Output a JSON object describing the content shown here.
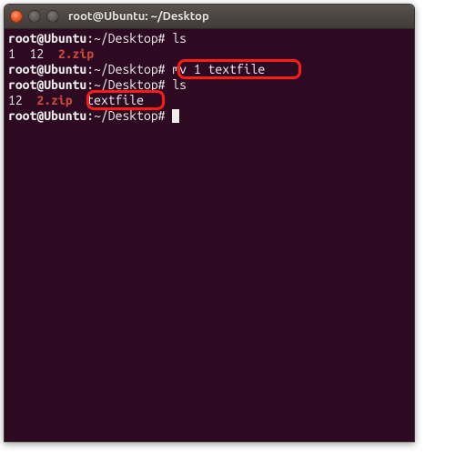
{
  "window": {
    "title": "root@Ubuntu: ~/Desktop"
  },
  "prompt": {
    "user_host": "root@Ubuntu",
    "path": "~/Desktop",
    "sep": ":",
    "end": "#"
  },
  "lines": {
    "cmd_ls1": "ls",
    "cmd_mv": "mv 1 textfile",
    "cmd_ls2": "ls",
    "cmd_empty": "",
    "ls1_item1": "1",
    "ls1_item2": "12",
    "ls1_item3": "2.zip",
    "ls2_item1": "12",
    "ls2_item2": "2.zip",
    "ls2_item3": "textfile"
  },
  "annotations": {
    "box1_label": "mv-command-highlight",
    "box2_label": "new-filename-highlight"
  }
}
